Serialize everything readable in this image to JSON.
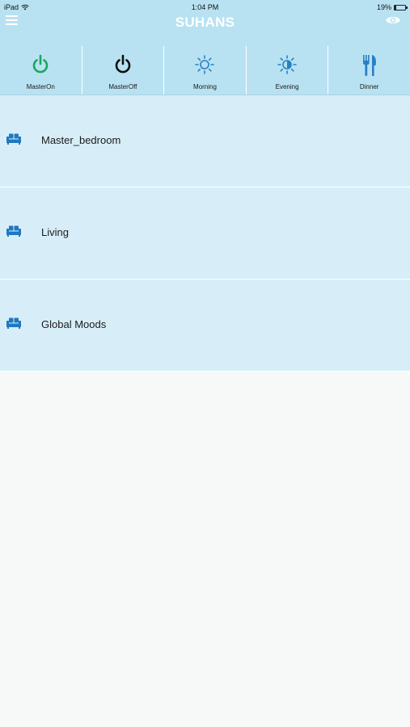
{
  "status_bar": {
    "device": "iPad",
    "time": "1:04 PM",
    "battery": "19%",
    "battery_level": 0.19
  },
  "header": {
    "title": "SUHANS",
    "menu_icon": "hamburger-menu-icon",
    "right_icon": "eye-icon"
  },
  "scenes": [
    {
      "label": "MasterOn",
      "icon": "power-icon",
      "color": "#1aa85a"
    },
    {
      "label": "MasterOff",
      "icon": "power-icon",
      "color": "#111111"
    },
    {
      "label": "Morning",
      "icon": "sun-icon",
      "color": "#2a7fc4"
    },
    {
      "label": "Evening",
      "icon": "half-sun-icon",
      "color": "#2a7fc4"
    },
    {
      "label": "Dinner",
      "icon": "fork-knife-icon",
      "color": "#2a7fc4"
    }
  ],
  "rooms": [
    {
      "label": "Master_bedroom",
      "icon": "sofa-icon"
    },
    {
      "label": "Living",
      "icon": "sofa-icon"
    },
    {
      "label": "Global Moods",
      "icon": "sofa-icon"
    }
  ],
  "colors": {
    "header_bg": "#b8e2f2",
    "row_bg": "#d7eef8",
    "icon_blue": "#1f78c1",
    "page_bg": "#f7f8f8"
  }
}
